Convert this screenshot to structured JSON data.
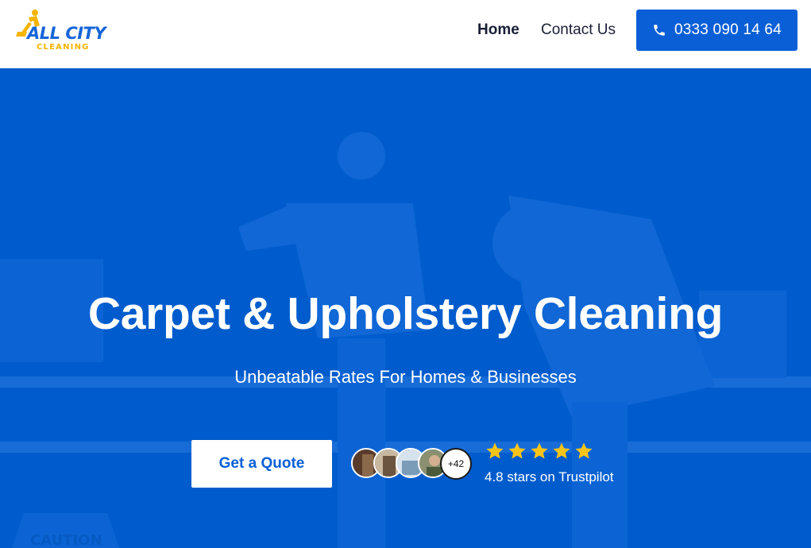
{
  "header": {
    "logo": {
      "line1": "ALL CITY",
      "line2": "CLEANING"
    },
    "nav": [
      {
        "label": "Home"
      },
      {
        "label": "Contact Us"
      }
    ],
    "phone": {
      "number": "0333 090 14 64",
      "icon": "phone-icon"
    }
  },
  "hero": {
    "title": "Carpet & Upholstery Cleaning",
    "subtitle": "Unbeatable Rates For Homes & Businesses",
    "cta_label": "Get a Quote",
    "reviewers_more": "+42",
    "stars": 5,
    "rating_text": "4.8 stars on Trustpilot",
    "bg_sign_text": "CAUTION"
  },
  "colors": {
    "brand_blue": "#005ccc",
    "button_blue": "#0a5fd6",
    "star_yellow": "#f9c41a",
    "logo_yellow": "#f4b400"
  }
}
